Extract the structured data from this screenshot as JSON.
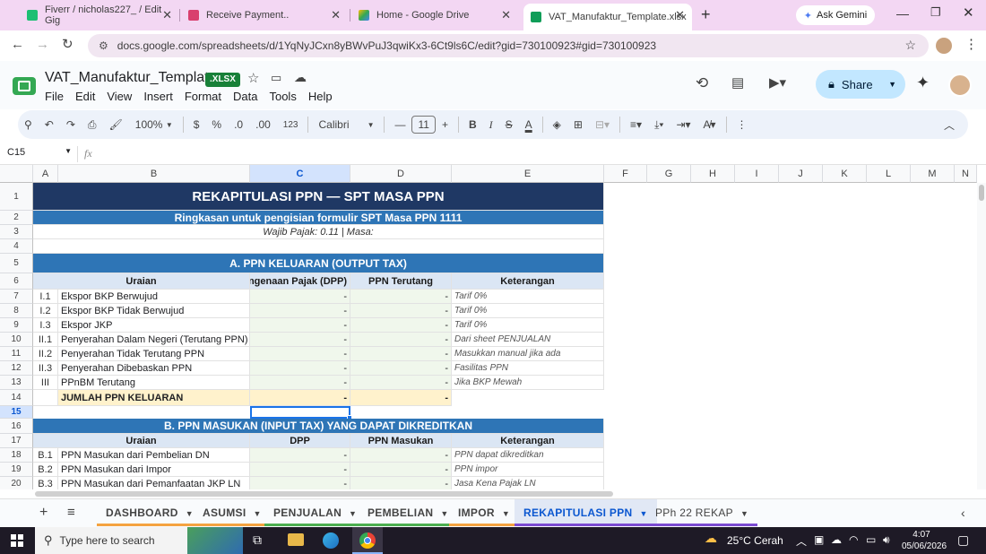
{
  "browser": {
    "tabs": [
      {
        "label": "Fiverr / nicholas227_ / Edit Gig",
        "color": "#1dbf73"
      },
      {
        "label": "Receive Payment..",
        "color": "#d93f6e"
      },
      {
        "label": "Home - Google Drive",
        "color": "#4285f4"
      },
      {
        "label": "VAT_Manufaktur_Template.xlsx",
        "color": "#0f9d58"
      }
    ],
    "new_tab": "+",
    "gemini": "Ask Gemini",
    "url": "docs.google.com/spreadsheets/d/1YqNyJCxn8yBWvPuJ3qwiKx3-6Ct9ls6C/edit?gid=730100923#gid=730100923"
  },
  "doc": {
    "title": "VAT_Manufaktur_Template",
    "badge": ".XLSX",
    "menus": [
      "File",
      "Edit",
      "View",
      "Insert",
      "Format",
      "Data",
      "Tools",
      "Help"
    ],
    "share": "Share"
  },
  "toolbar": {
    "zoom": "100%",
    "currency": "$",
    "percent": "%",
    "dec_down": ".0",
    "dec_up": ".00",
    "number_fmt": "123",
    "font": "Calibri",
    "font_size": "11",
    "bold": "B",
    "italic": "I",
    "strike": "S",
    "text_color": "A"
  },
  "formula": {
    "cell_ref": "C15",
    "fx": "fx"
  },
  "columns": [
    "A",
    "B",
    "C",
    "D",
    "E",
    "F",
    "G",
    "H",
    "I",
    "J",
    "K",
    "L",
    "M",
    "N"
  ],
  "rows": [
    "1",
    "2",
    "3",
    "4",
    "5",
    "6",
    "7",
    "8",
    "9",
    "10",
    "11",
    "12",
    "13",
    "14",
    "15",
    "16",
    "17",
    "18",
    "19",
    "20"
  ],
  "sheet": {
    "title": "REKAPITULASI PPN — SPT MASA PPN",
    "subtitle": "Ringkasan untuk pengisian formulir SPT Masa PPN 1111",
    "info": "Wajib Pajak: 0.11 | Masa:",
    "section_a": "A. PPN KELUARAN (OUTPUT TAX)",
    "section_a_headers": [
      "Uraian",
      "Dasar Pengenaan Pajak (DPP)",
      "PPN Terutang",
      "Keterangan"
    ],
    "section_a_rows": [
      {
        "no": "I.1",
        "uraian": "Ekspor BKP Berwujud",
        "dpp": "-",
        "ppn": "-",
        "ket": "Tarif 0%"
      },
      {
        "no": "I.2",
        "uraian": "Ekspor BKP Tidak Berwujud",
        "dpp": "-",
        "ppn": "-",
        "ket": "Tarif 0%"
      },
      {
        "no": "I.3",
        "uraian": "Ekspor JKP",
        "dpp": "-",
        "ppn": "-",
        "ket": "Tarif 0%"
      },
      {
        "no": "II.1",
        "uraian": "Penyerahan Dalam Negeri (Terutang PPN)",
        "dpp": "-",
        "ppn": "-",
        "ket": "Dari sheet PENJUALAN"
      },
      {
        "no": "II.2",
        "uraian": "Penyerahan Tidak Terutang PPN",
        "dpp": "-",
        "ppn": "-",
        "ket": "Masukkan manual jika ada"
      },
      {
        "no": "II.3",
        "uraian": "Penyerahan Dibebaskan PPN",
        "dpp": "-",
        "ppn": "-",
        "ket": "Fasilitas PPN"
      },
      {
        "no": "III",
        "uraian": "PPnBM Terutang",
        "dpp": "-",
        "ppn": "-",
        "ket": "Jika BKP Mewah"
      }
    ],
    "total_a": {
      "label": "JUMLAH PPN KELUARAN",
      "dpp": "-",
      "ppn": "-"
    },
    "section_b": "B. PPN MASUKAN (INPUT TAX) YANG DAPAT DIKREDITKAN",
    "section_b_headers": [
      "Uraian",
      "DPP",
      "PPN Masukan",
      "Keterangan"
    ],
    "section_b_rows": [
      {
        "no": "B.1",
        "uraian": "PPN Masukan dari Pembelian DN",
        "dpp": "-",
        "ppn": "-",
        "ket": "PPN dapat dikreditkan"
      },
      {
        "no": "B.2",
        "uraian": "PPN Masukan dari Impor",
        "dpp": "-",
        "ppn": "-",
        "ket": "PPN impor"
      },
      {
        "no": "B.3",
        "uraian": "PPN Masukan dari Pemanfaatan JKP LN",
        "dpp": "-",
        "ppn": "-",
        "ket": "Jasa Kena Pajak LN"
      }
    ]
  },
  "sheet_tabs": [
    {
      "label": "DASHBOARD",
      "color": "#f4a340"
    },
    {
      "label": "ASUMSI",
      "color": "#f4a340"
    },
    {
      "label": "PENJUALAN",
      "color": "#4caf50"
    },
    {
      "label": "PEMBELIAN",
      "color": "#4caf50"
    },
    {
      "label": "IMPOR",
      "color": "#f4a340"
    },
    {
      "label": "REKAPITULASI PPN",
      "color": "#7b4bd1"
    },
    {
      "label": "PPh 22 REKAP",
      "color": "#7b4bd1"
    }
  ],
  "taskbar": {
    "search": "Type here to search",
    "weather": "25°C  Cerah",
    "time": "4:07",
    "date": "05/06/2026"
  }
}
